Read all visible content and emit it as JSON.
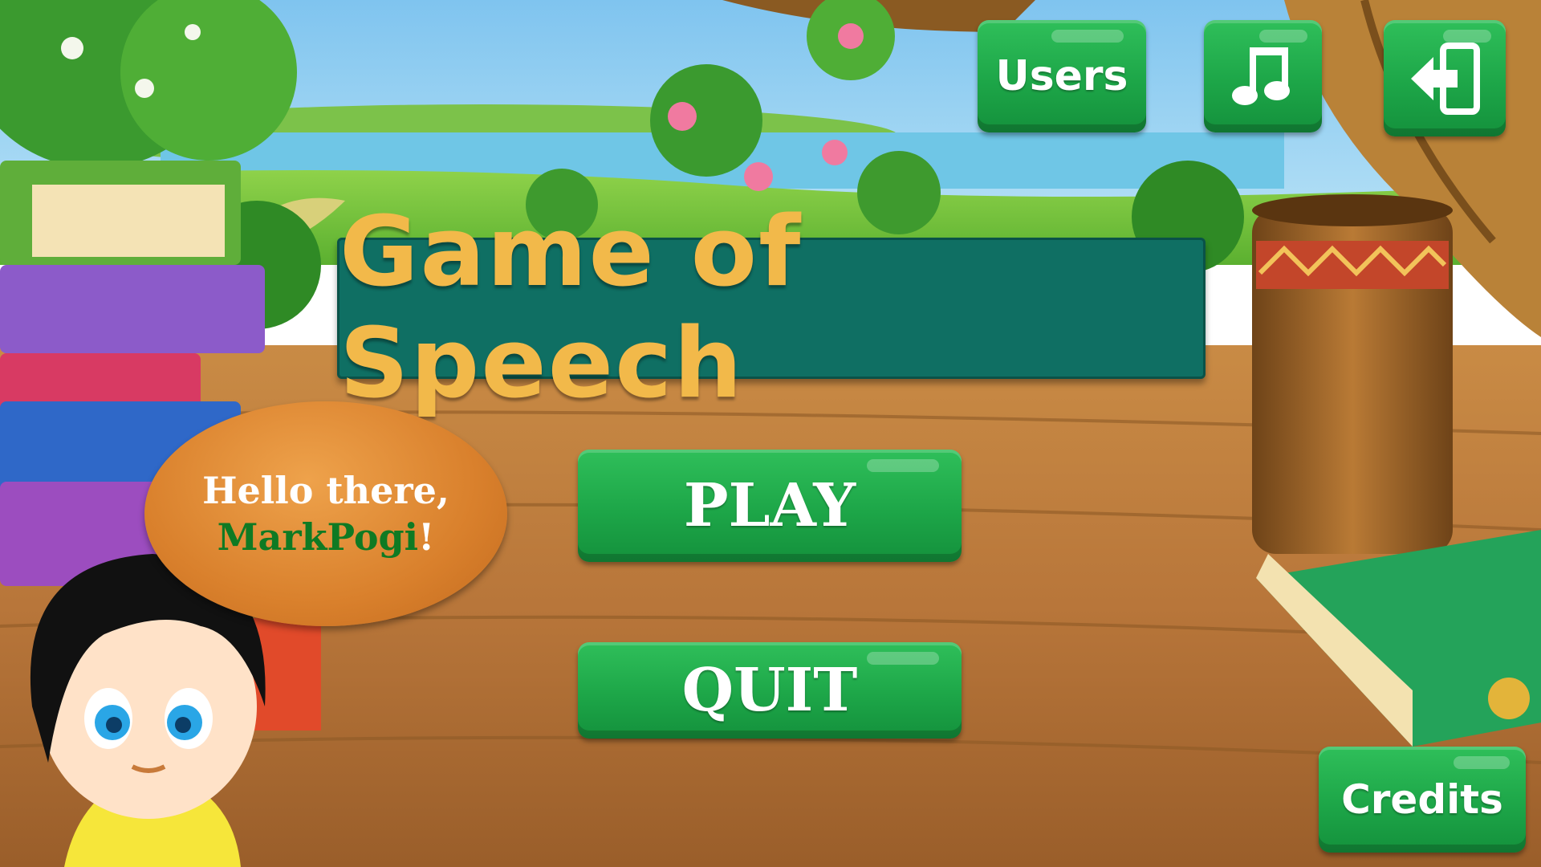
{
  "game": {
    "title": "Game of Speech"
  },
  "top_bar": {
    "users_label": "Users",
    "music_icon": "music-note-icon",
    "exit_icon": "exit-arrow-icon"
  },
  "greeting": {
    "line1": "Hello there,",
    "username": "MarkPogi",
    "suffix": "!"
  },
  "menu": {
    "play_label": "PLAY",
    "quit_label": "QUIT"
  },
  "footer": {
    "credits_label": "Credits"
  },
  "colors": {
    "button_green": "#1da648",
    "title_banner": "#0f6f63",
    "title_text": "#f2b94a",
    "bubble_orange": "#d9802c",
    "username_green": "#0f7a23"
  }
}
